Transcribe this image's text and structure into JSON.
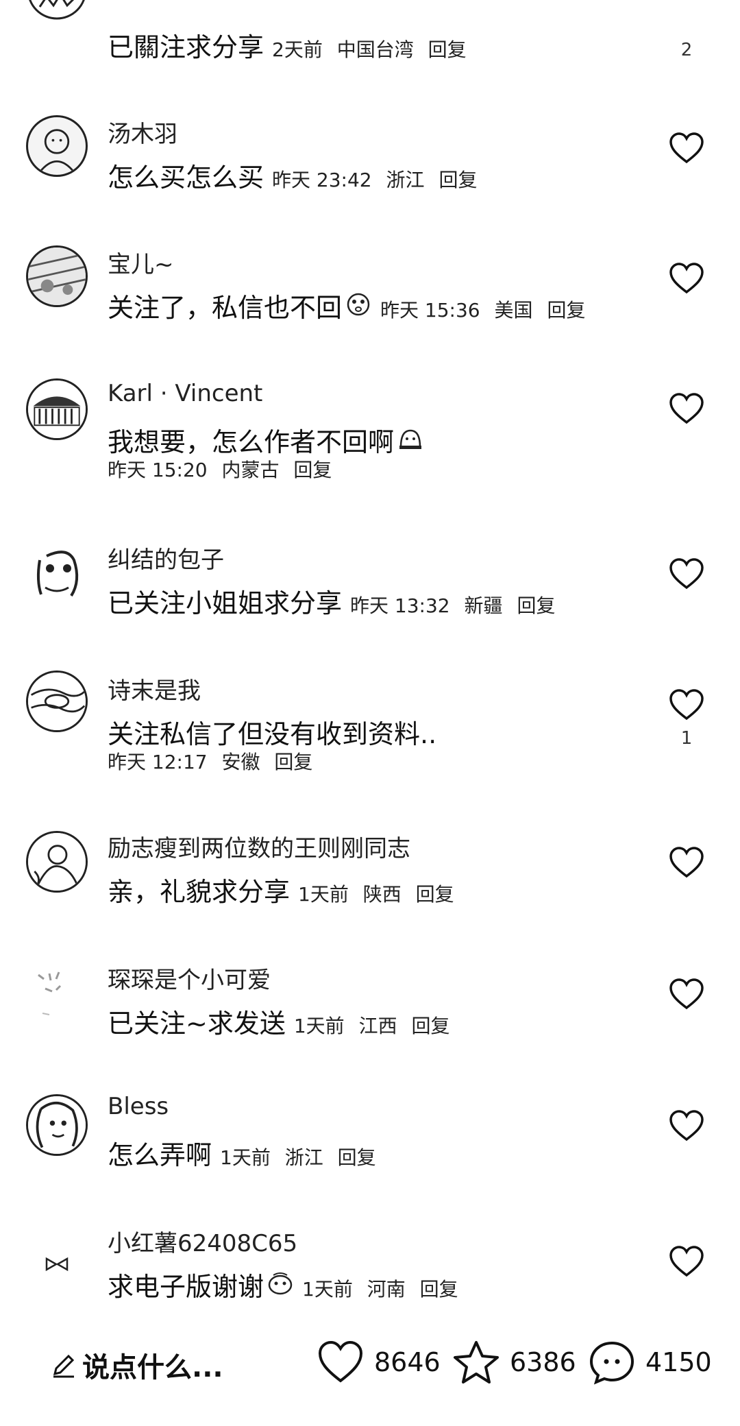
{
  "comments": [
    {
      "name": "",
      "text": "已關注求分享",
      "time": "2天前",
      "location": "中国台湾",
      "reply": "回复",
      "likes": "2",
      "meta_inline": true
    },
    {
      "name": "汤木羽",
      "text": "怎么买怎么买",
      "time": "昨天 23:42",
      "location": "浙江",
      "reply": "回复",
      "likes": "",
      "meta_inline": true
    },
    {
      "name": "宝儿~",
      "text": "关注了，私信也不回",
      "time": "昨天 15:36",
      "location": "美国",
      "reply": "回复",
      "likes": "",
      "meta_inline": true
    },
    {
      "name": "Karl · Vincent",
      "text": "我想要，怎么作者不回啊",
      "time": "昨天 15:20",
      "location": "内蒙古",
      "reply": "回复",
      "likes": "",
      "meta_inline": false
    },
    {
      "name": "纠结的包子",
      "text": "已关注小姐姐求分享",
      "time": "昨天 13:32",
      "location": "新疆",
      "reply": "回复",
      "likes": "",
      "meta_inline": true
    },
    {
      "name": "诗末是我",
      "text": "关注私信了但没有收到资料..",
      "time": "昨天 12:17",
      "location": "安徽",
      "reply": "回复",
      "likes": "1",
      "meta_inline": false
    },
    {
      "name": "励志瘦到两位数的王则刚同志",
      "text": "亲，礼貌求分享",
      "time": "1天前",
      "location": "陕西",
      "reply": "回复",
      "likes": "",
      "meta_inline": true
    },
    {
      "name": "琛琛是个小可爱",
      "text": "已关注~求发送",
      "time": "1天前",
      "location": "江西",
      "reply": "回复",
      "likes": "",
      "meta_inline": true
    },
    {
      "name": "Bless",
      "text": "怎么弄啊",
      "time": "1天前",
      "location": "浙江",
      "reply": "回复",
      "likes": "",
      "meta_inline": true
    },
    {
      "name": "小红薯62408C65",
      "text": "求电子版谢谢",
      "time": "1天前",
      "location": "河南",
      "reply": "回复",
      "likes": "",
      "meta_inline": true
    }
  ],
  "bottom_bar": {
    "say_label": "说点什么...",
    "likes_count": "8646",
    "favorites_count": "6386",
    "comments_count": "4150"
  },
  "icons": {
    "like": "heart-outline-icon",
    "favorite": "star-outline-icon",
    "comment": "chat-bubble-icon",
    "edit": "pencil-icon"
  }
}
